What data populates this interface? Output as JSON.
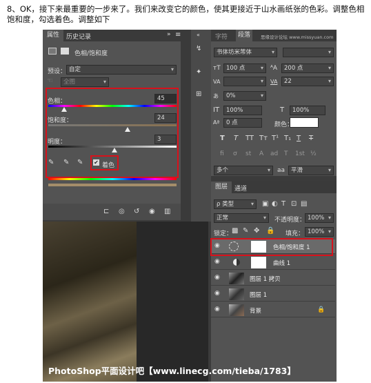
{
  "intro_text": "8、OK，接下来最重要的一步来了。我们来改变它的颜色，使其更接近于山水画纸张的色彩。调整色相饱和度，勾选着色。调整如下",
  "properties": {
    "tabs": [
      "属性",
      "历史记录"
    ],
    "collapse": "»",
    "title": "色相/饱和度",
    "preset_label": "预设：",
    "preset_value": "自定",
    "channel_value": "全图",
    "hue_label": "色相：",
    "hue_value": "45",
    "hue_level": 0.125,
    "sat_label": "饱和度：",
    "sat_value": "24",
    "sat_level": 0.62,
    "light_label": "明度：",
    "light_value": "3",
    "light_level": 0.515,
    "colorize_label": "着色",
    "colorize_checked": "✔"
  },
  "character": {
    "tabs": [
      "字符",
      "段落"
    ],
    "watermark_top": "思缘设计论坛 www.missyuan.com",
    "font_family": "书体坊米芾体",
    "font_size": "100 点",
    "leading": "200 点",
    "kerning": "",
    "tracking": "22",
    "scale_pct": "0%",
    "vscale": "100%",
    "hscale": "100%",
    "baseline": "0 点",
    "color_label": "颜色：",
    "style_buttons": [
      "T",
      "T",
      "TT",
      "Tт",
      "T¹",
      "T₁",
      "T",
      "T"
    ],
    "ot_buttons": [
      "fi",
      "ơ",
      "st",
      "A",
      "ad",
      "T",
      "1st",
      "½"
    ],
    "language": "多个",
    "aa_label": "aa",
    "aa_value": "平滑"
  },
  "layers": {
    "tabs": [
      "图层",
      "通道"
    ],
    "filter_label": "ρ 类型",
    "blend_mode": "正常",
    "opacity_label": "不透明度：",
    "opacity_value": "100%",
    "lock_label": "锁定：",
    "fill_label": "填充：",
    "fill_value": "100%",
    "items": [
      {
        "name": "色相/饱和度 1"
      },
      {
        "name": "曲线 1"
      },
      {
        "name": "图层 1 拷贝"
      },
      {
        "name": "图层 1"
      },
      {
        "name": "背景"
      }
    ]
  },
  "watermark": "PhotoShop平面设计吧【www.linecg.com/tieba/1783】"
}
